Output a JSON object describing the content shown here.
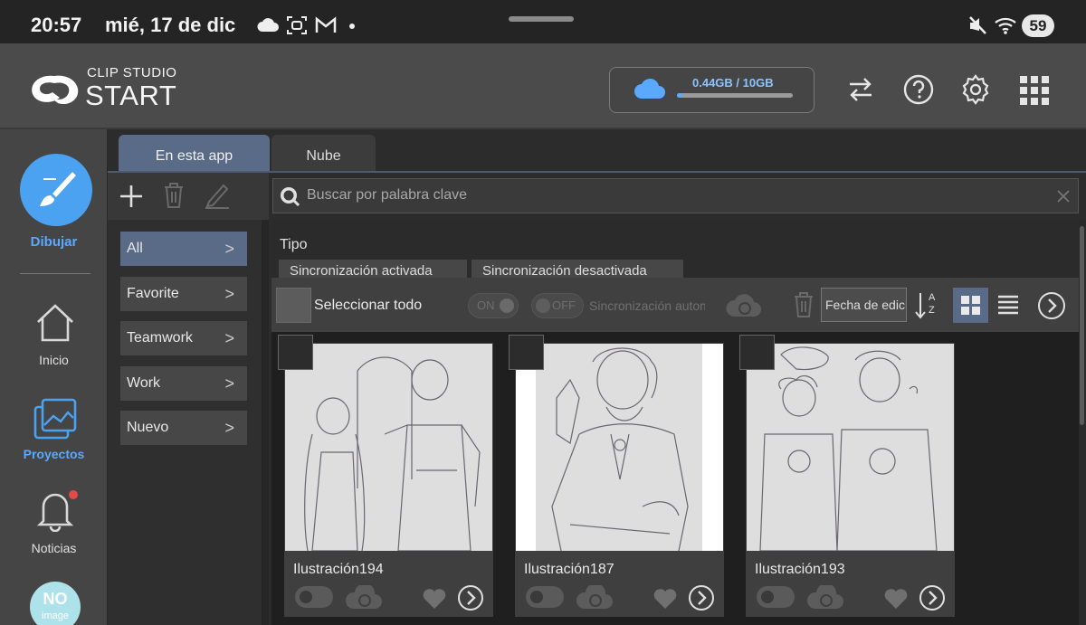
{
  "status_bar": {
    "time": "20:57",
    "date": "mié, 17 de dic",
    "battery": "59",
    "icons": [
      "cloud-icon",
      "screenshot-icon",
      "gmail-icon",
      "dot-icon",
      "mute-icon",
      "wifi-icon"
    ]
  },
  "header": {
    "logo_line1": "CLIP STUDIO",
    "logo_line2": "START",
    "storage_text": "0.44GB / 10GB",
    "storage_fraction": 0.044,
    "accent": "#5aa8ff"
  },
  "rail": {
    "items": [
      {
        "label": "Dibujar",
        "icon": "brush-icon"
      },
      {
        "label": "Inicio",
        "icon": "home-icon"
      },
      {
        "label": "Proyectos",
        "icon": "gallery-icon"
      },
      {
        "label": "Noticias",
        "icon": "bell-icon"
      }
    ],
    "avatar_text1": "NO",
    "avatar_text2": "image"
  },
  "tabs": [
    {
      "label": "En esta app",
      "active": true
    },
    {
      "label": "Nube",
      "active": false
    }
  ],
  "folders": [
    {
      "label": "All",
      "active": true
    },
    {
      "label": "Favorite",
      "active": false
    },
    {
      "label": "Teamwork",
      "active": false
    },
    {
      "label": "Work",
      "active": false
    },
    {
      "label": "Nuevo",
      "active": false
    }
  ],
  "search": {
    "placeholder": "Buscar por palabra clave"
  },
  "filters": {
    "heading": "Tipo",
    "chips": [
      "Sincronización activada",
      "Sincronización desactivada"
    ]
  },
  "toolbar": {
    "select_all": "Seleccionar todo",
    "toggle_on": "ON",
    "toggle_off": "OFF",
    "sync_label": "Sincronización automática",
    "sort_label": "Fecha de edición",
    "sort_az": "A Z"
  },
  "cards": [
    {
      "name": "Ilustración194"
    },
    {
      "name": "Ilustración187"
    },
    {
      "name": "Ilustración193"
    }
  ]
}
